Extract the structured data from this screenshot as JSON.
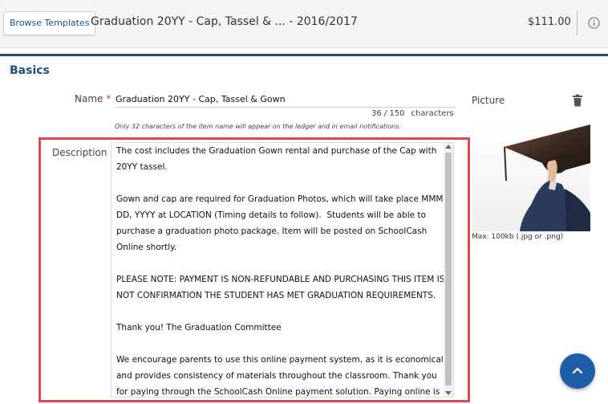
{
  "header": {
    "browse_label": "Browse Templates",
    "title": "Graduation 20YY - Cap, Tassel & ...  - 2016/2017",
    "price": "$111.00",
    "info_icon": "info-icon"
  },
  "section": {
    "title": "Basics"
  },
  "name_field": {
    "label": "Name",
    "required_marker": "*",
    "value": "Graduation 20YY - Cap, Tassel & Gown",
    "count": "36 / 150",
    "count_unit": "characters",
    "hint": "Only 32 characters of the item name will appear on the ledger and in email notifications."
  },
  "description": {
    "label": "Description",
    "text": "The cost includes the Graduation Gown rental and purchase of the Cap with 20YY tassel.\n\nGown and cap are required for Graduation Photos, which will take place MMM DD, YYYY at LOCATION (Timing details to follow).  Students will be able to purchase a graduation photo package. Item will be posted on SchoolCash Online shortly.\n\nPLEASE NOTE: PAYMENT IS NON-REFUNDABLE AND PURCHASING THIS ITEM IS NOT CONFIRMATION THE STUDENT HAS MET GRADUATION REQUIREMENTS.\n\nThank you! The Graduation Committee\n\nWe encourage parents to use this online payment system, as it is economical and provides consistency of materials throughout the classroom. Thank you for paying through the SchoolCash Online payment solution. Paying online is a quick, efficient, and safe."
  },
  "picture": {
    "label": "Picture",
    "max_note": "Max: 100kb (.jpg or .png)",
    "delete_icon": "trash-icon"
  },
  "fab": {
    "icon": "chevron-up-icon"
  },
  "colors": {
    "accent": "#1f4f84",
    "highlight": "#e14a4a",
    "fab": "#1f5ea8"
  }
}
